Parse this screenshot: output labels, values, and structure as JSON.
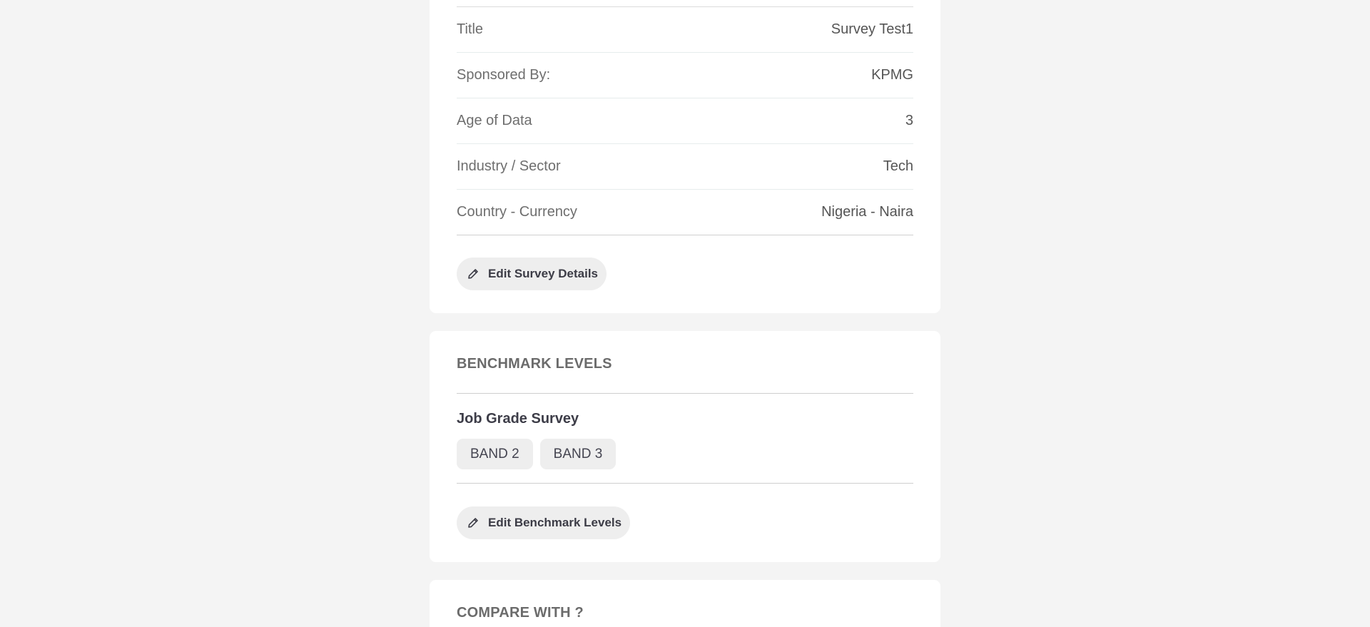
{
  "survey_details": {
    "rows": [
      {
        "label": "Title",
        "value": "Survey Test1"
      },
      {
        "label": "Sponsored By:",
        "value": "KPMG"
      },
      {
        "label": "Age of Data",
        "value": "3"
      },
      {
        "label": "Industry / Sector",
        "value": "Tech"
      },
      {
        "label": "Country - Currency",
        "value": "Nigeria - Naira"
      }
    ],
    "edit_label": "Edit Survey Details",
    "edit_icon": "pencil-icon"
  },
  "benchmark": {
    "title": "BENCHMARK LEVELS",
    "group_title": "Job Grade Survey",
    "levels": [
      "BAND 2",
      "BAND 3"
    ],
    "edit_label": "Edit Benchmark Levels",
    "edit_icon": "pencil-icon"
  },
  "compare": {
    "title": "COMPARE WITH ?"
  }
}
